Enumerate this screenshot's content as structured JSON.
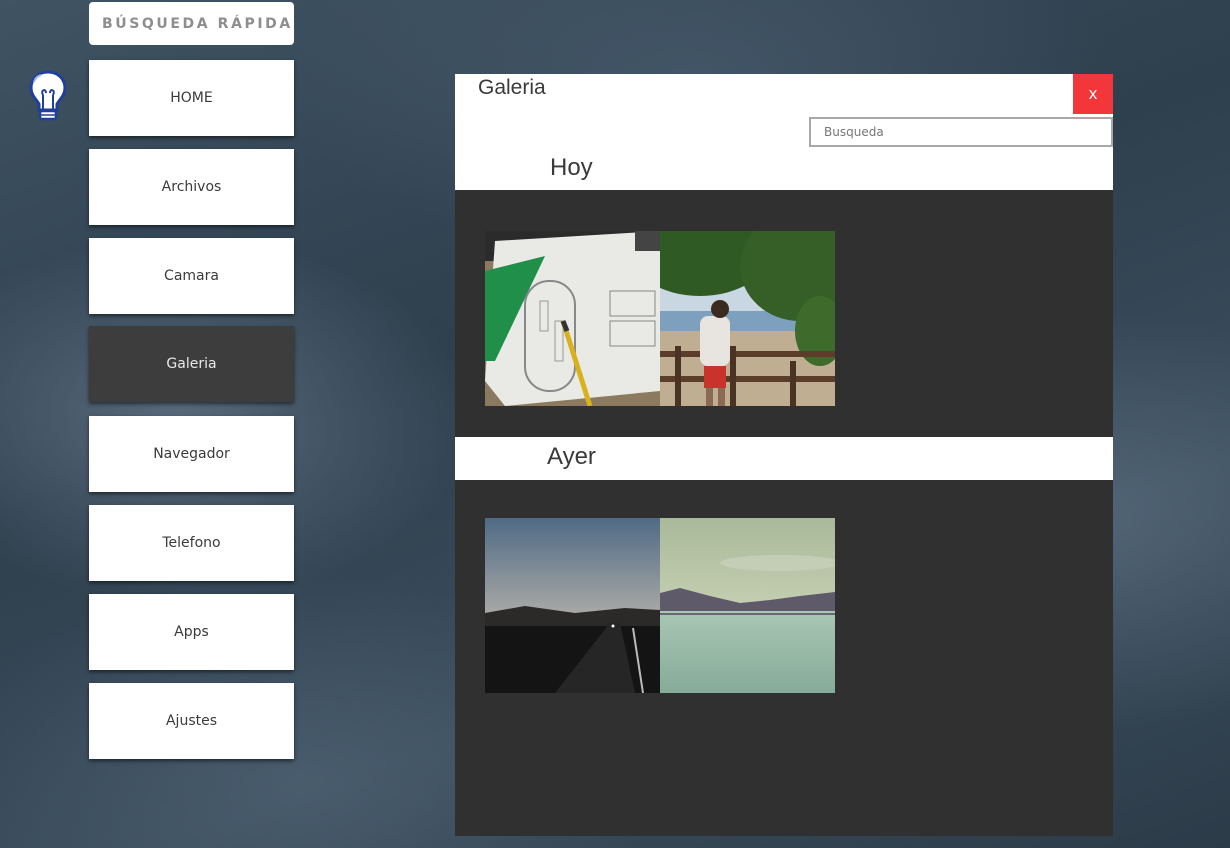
{
  "quick_search": {
    "label": "BÚSQUEDA RÁPIDA"
  },
  "icons": {
    "assistant": "lightbulb-icon"
  },
  "menu": {
    "items": [
      {
        "label": "HOME",
        "active": false
      },
      {
        "label": "Archivos",
        "active": false
      },
      {
        "label": "Camara",
        "active": false
      },
      {
        "label": "Galeria",
        "active": true
      },
      {
        "label": "Navegador",
        "active": false
      },
      {
        "label": "Telefono",
        "active": false
      },
      {
        "label": "Apps",
        "active": false
      },
      {
        "label": "Ajustes",
        "active": false
      }
    ]
  },
  "gallery": {
    "title": "Galeria",
    "close_label": "x",
    "search_placeholder": "Busqueda",
    "sections": [
      {
        "title": "Hoy"
      },
      {
        "title": "Ayer"
      }
    ]
  },
  "colors": {
    "close_button": "#f2363a",
    "active_menu": "#3d3d3d",
    "gallery_background": "#303030"
  }
}
